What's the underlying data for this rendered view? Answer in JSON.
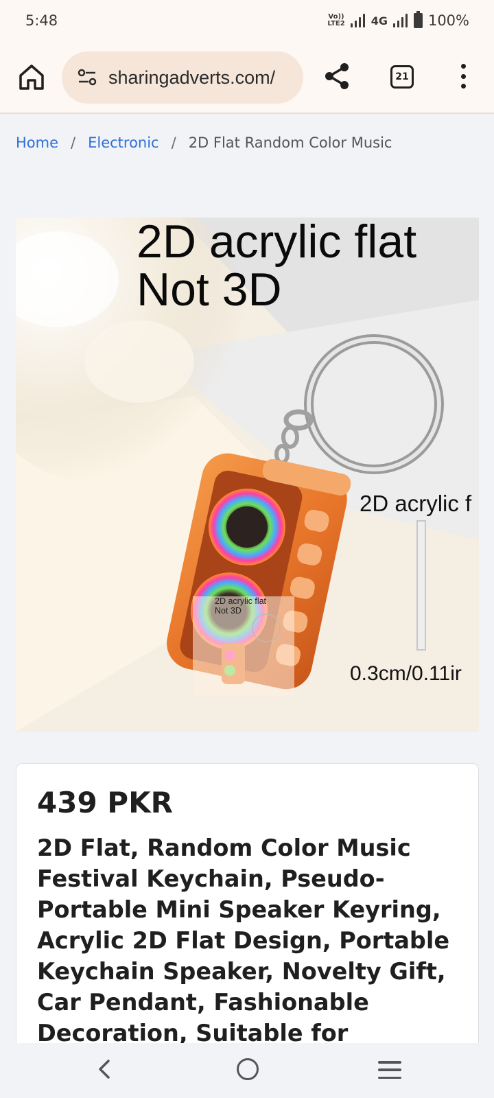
{
  "status_bar": {
    "time": "5:48",
    "volte": "Vo)) LTE2",
    "network": "4G",
    "battery": "100%"
  },
  "browser": {
    "url": "sharingadverts.com/",
    "tab_count": "21",
    "icons": [
      "home-icon",
      "site-settings-icon",
      "share-icon",
      "tab-switcher-icon",
      "more-vert-icon"
    ]
  },
  "breadcrumb": {
    "home": "Home",
    "separator": "/",
    "category": "Electronic",
    "current": "2D Flat Random Color Music"
  },
  "product_image": {
    "headline_line1": "2D acrylic flat",
    "headline_line2": "Not 3D",
    "side_label": "2D acrylic f",
    "dimension": "0.3cm/0.11ir",
    "thumb_line1": "2D acrylic flat",
    "thumb_line2": "Not 3D"
  },
  "product": {
    "price": "439 PKR",
    "title": "2D Flat, Random Color Music Festival Keychain, Pseudo-Portable Mini Speaker Keyring, Acrylic 2D Flat Design, Portable Keychain Speaker, Novelty Gift, Car Pendant, Fashionable Decoration, Suitable for"
  },
  "nav_bar": {
    "icons": [
      "back-icon",
      "home-circle-icon",
      "recents-icon"
    ]
  },
  "colors": {
    "link": "#2f6fd6",
    "browser_bar": "#fdf8f3",
    "url_pill": "#f6e6da",
    "speaker_orange": "#e8762a"
  }
}
